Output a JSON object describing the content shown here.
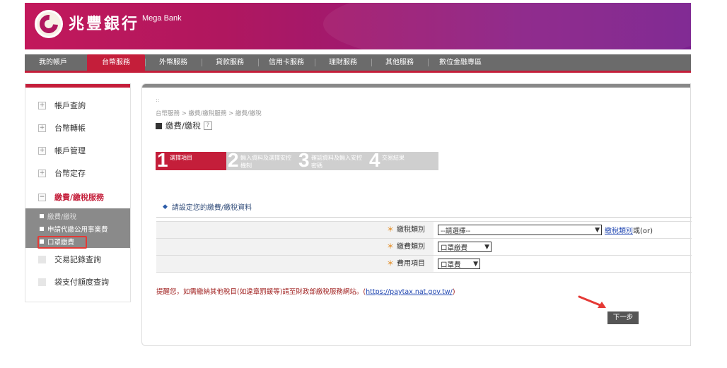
{
  "header": {
    "brand_zh": "兆豐銀行",
    "brand_en": "Mega Bank"
  },
  "nav": {
    "items": [
      "我的帳戶",
      "台幣服務",
      "外幣服務",
      "貸款服務",
      "信用卡服務",
      "理財服務",
      "其他服務",
      "數位金融專區"
    ],
    "active_index": 1
  },
  "sidebar": {
    "items": [
      {
        "label": "帳戶查詢",
        "icon": "plus-icon"
      },
      {
        "label": "台幣轉帳",
        "icon": "plus-icon"
      },
      {
        "label": "帳戶管理",
        "icon": "plus-icon"
      },
      {
        "label": "台幣定存",
        "icon": "plus-icon"
      },
      {
        "label": "繳費/繳稅服務",
        "icon": "minus-icon"
      }
    ],
    "sub_items": [
      "繳費/繳稅",
      "申請代繳公用事業費",
      "口罩繳費"
    ],
    "bottom_items": [
      "交易記錄查詢",
      "袋支付額度查詢"
    ]
  },
  "main": {
    "tiny": "::",
    "breadcrumb": "台幣服務 > 繳費/繳稅服務 > 繳費/繳稅",
    "title": "繳費/繳稅",
    "help": "?",
    "steps": [
      {
        "num": "1",
        "label": "選擇項目"
      },
      {
        "num": "2",
        "label": "輸入資料及選擇安控機制"
      },
      {
        "num": "3",
        "label": "確認資料及輸入安控密碼"
      },
      {
        "num": "4",
        "label": "交易結果"
      }
    ],
    "section_title": "請設定您的繳費/繳稅資料",
    "form": {
      "tax_type_label": "繳稅類別",
      "tax_type_value": "--請選擇--",
      "tax_type_link": "繳稅類別",
      "tax_type_or": "或(or)",
      "fee_type_label": "繳費類別",
      "fee_type_value": "口罩繳費",
      "fee_item_label": "費用項目",
      "fee_item_value": "口罩費"
    },
    "notice_text": "提醒您，如需繳納其他稅目(如違章罰鍰等)請至財政部繳稅服務網站。(",
    "notice_url": "https://paytax.nat.gov.tw/",
    "notice_close": ")",
    "next_button": "下一步"
  },
  "colors": {
    "brand_red": "#c41e3a",
    "nav_gray": "#6b6b6b",
    "highlight_red": "#e53935"
  }
}
